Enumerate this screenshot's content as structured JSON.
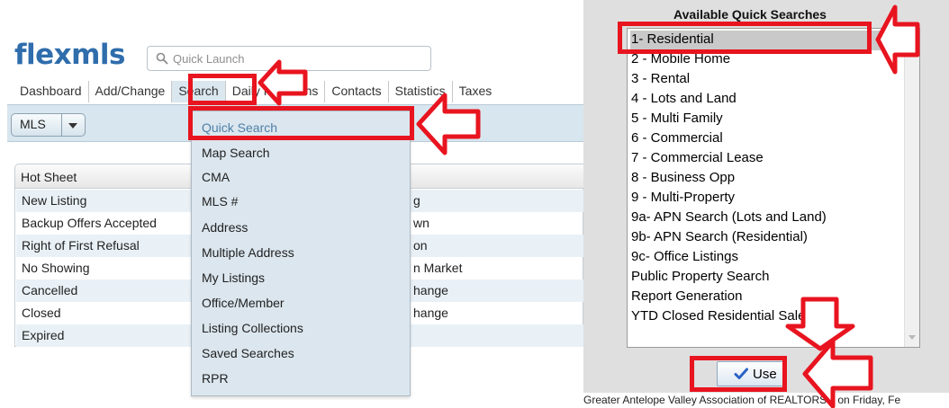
{
  "left_panel": {
    "logo_text": "flexmls",
    "quick_launch": {
      "placeholder": "Quick Launch",
      "icon": "search-icon"
    },
    "tabs": [
      {
        "label": "Dashboard"
      },
      {
        "label": "Add/Change"
      },
      {
        "label": "Search",
        "active": true
      },
      {
        "label": "Daily Functions"
      },
      {
        "label": "Contacts"
      },
      {
        "label": "Statistics"
      },
      {
        "label": "Taxes"
      }
    ],
    "mls_button": {
      "label": "MLS",
      "icon": "chevron-down-icon"
    },
    "hot_sheet": {
      "title": "Hot Sheet",
      "left_items": [
        "New Listing",
        "Backup Offers Accepted",
        "Right of First Refusal",
        "No Showing",
        "Cancelled",
        "Closed",
        "Expired"
      ],
      "right_items": [
        "g",
        "wn",
        "on",
        "n Market",
        "hange",
        "hange"
      ]
    },
    "search_menu": [
      "Quick Search",
      "Map Search",
      "CMA",
      "MLS #",
      "Address",
      "Multiple Address",
      "My Listings",
      "Office/Member",
      "Listing Collections",
      "Saved Searches",
      "RPR"
    ],
    "search_menu_highlighted": "Quick Search"
  },
  "right_panel": {
    "title": "Available Quick Searches",
    "items": [
      "1- Residential",
      "2 - Mobile Home",
      "3 - Rental",
      "4 - Lots and Land",
      "5 - Multi Family",
      "6 - Commercial",
      "7 - Commercial Lease",
      "8 - Business Opp",
      "9 - Multi-Property",
      "9a- APN Search (Lots and Land)",
      "9b- APN Search (Residential)",
      "9c- Office Listings",
      "Public Property Search",
      "Report Generation",
      "YTD Closed Residential Sales"
    ],
    "selected": "1- Residential",
    "use_button": {
      "label": "Use",
      "icon": "checkmark-icon"
    },
    "footer": "Greater Antelope Valley Association of REALTORS® on Friday, Fe"
  },
  "colors": {
    "brand_blue": "#2f6dac",
    "menu_bg": "#dbe6ee",
    "annotation_red": "#e8141f",
    "row_alt": "#e9f1f7",
    "selected_row": "#c9c9c9"
  }
}
